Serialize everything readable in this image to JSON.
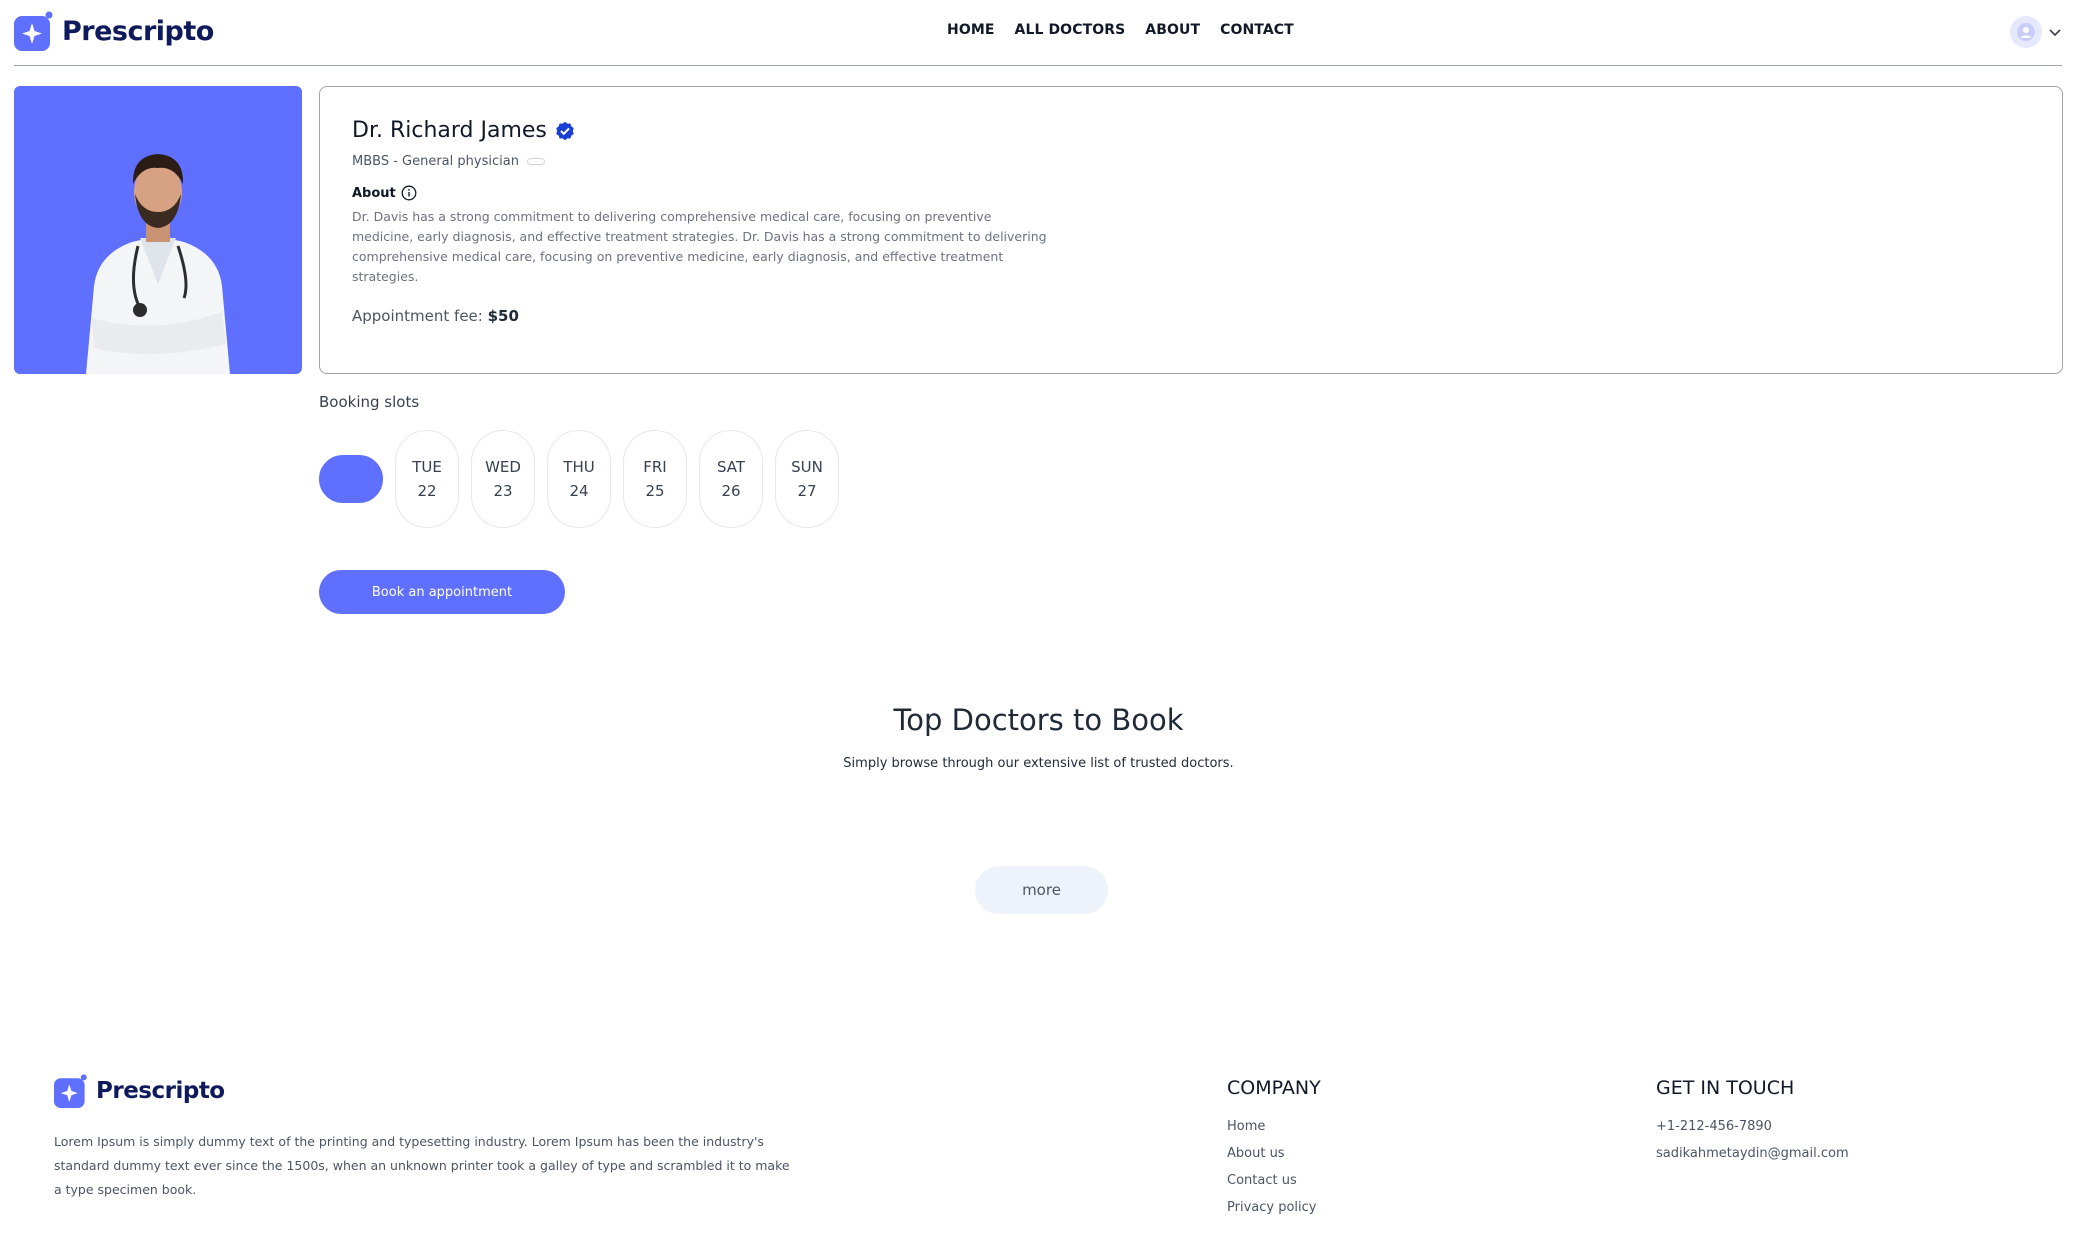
{
  "brand": {
    "name": "Prescripto",
    "accent": "#5f6fff",
    "text_color": "#0f1a5c"
  },
  "nav": {
    "items": [
      "HOME",
      "ALL DOCTORS",
      "ABOUT",
      "CONTACT"
    ]
  },
  "profile": {
    "avatar_icon": "user-avatar-icon",
    "menu_icon": "chevron-down-icon"
  },
  "doctor": {
    "name": "Dr. Richard James",
    "verified_icon": "verified-badge-icon",
    "degree": "MBBS - General physician",
    "experience": "",
    "about_label": "About",
    "about_icon": "info-icon",
    "about_text": "Dr. Davis has a strong commitment to delivering comprehensive medical care, focusing on preventive medicine, early diagnosis, and effective treatment strategies. Dr. Davis has a strong commitment to delivering comprehensive medical care, focusing on preventive medicine, early diagnosis, and effective treatment strategies.",
    "fee_label": "Appointment fee:",
    "fee_value": "$50"
  },
  "booking": {
    "title": "Booking slots",
    "slots": [
      {
        "day": "",
        "date": "",
        "selected": true
      },
      {
        "day": "TUE",
        "date": "22",
        "selected": false
      },
      {
        "day": "WED",
        "date": "23",
        "selected": false
      },
      {
        "day": "THU",
        "date": "24",
        "selected": false
      },
      {
        "day": "FRI",
        "date": "25",
        "selected": false
      },
      {
        "day": "SAT",
        "date": "26",
        "selected": false
      },
      {
        "day": "SUN",
        "date": "27",
        "selected": false
      }
    ],
    "button_label": "Book an appointment"
  },
  "top_doctors": {
    "title": "Top Doctors to Book",
    "subtitle": "Simply browse through our extensive list of trusted doctors.",
    "more_label": "more"
  },
  "footer": {
    "description": "Lorem Ipsum is simply dummy text of the printing and typesetting industry. Lorem Ipsum has been the industry's standard dummy text ever since the 1500s, when an unknown printer took a galley of type and scrambled it to make a type specimen book.",
    "company": {
      "title": "COMPANY",
      "links": [
        "Home",
        "About us",
        "Contact us",
        "Privacy policy"
      ]
    },
    "contact": {
      "title": "GET IN TOUCH",
      "phone": "+1-212-456-7890",
      "email": "sadikahmetaydin@gmail.com"
    }
  }
}
